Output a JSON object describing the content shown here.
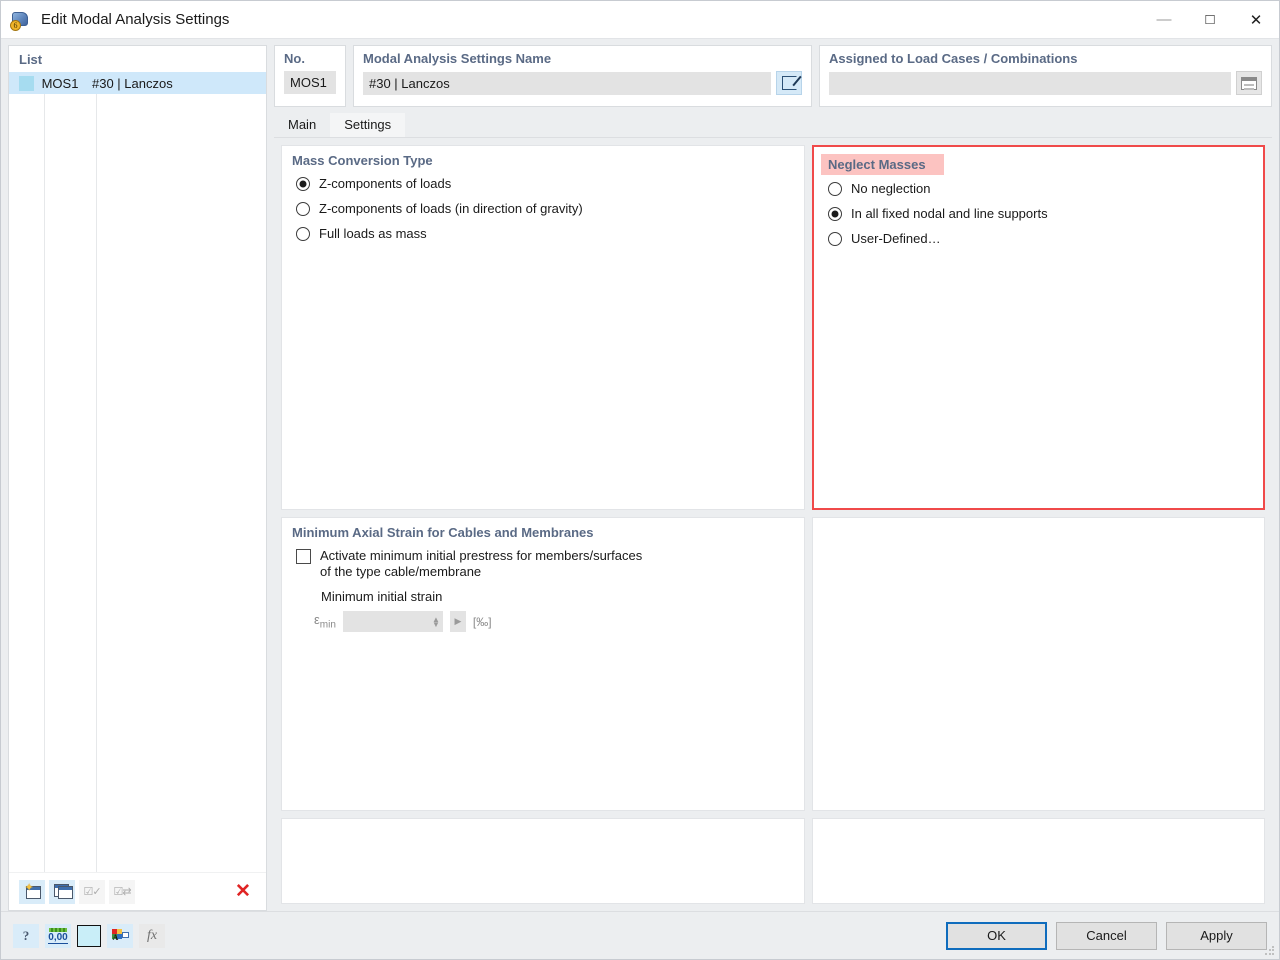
{
  "window": {
    "title": "Edit Modal Analysis Settings",
    "icon": "modal-analysis-cube-icon",
    "minimize": "—",
    "maximize": "□",
    "close": "✕"
  },
  "list": {
    "header": "List",
    "rows": [
      {
        "swatch_color": "#a6dcf0",
        "id": "MOS1",
        "name": "#30 | Lanczos"
      }
    ],
    "toolbar": [
      {
        "name": "new-item-button",
        "enabled": true
      },
      {
        "name": "copy-item-button",
        "enabled": true
      },
      {
        "name": "select-all-button",
        "enabled": false
      },
      {
        "name": "invert-selection-button",
        "enabled": false
      },
      {
        "name": "delete-item-button",
        "label": "✕",
        "enabled": true
      }
    ]
  },
  "no_field": {
    "label": "No.",
    "value": "MOS1"
  },
  "name_field": {
    "label": "Modal Analysis Settings Name",
    "value": "#30 | Lanczos",
    "edit_button": "edit-name-button"
  },
  "assigned_field": {
    "label": "Assigned to Load Cases / Combinations",
    "value": "",
    "placeholder": "",
    "picker_button": "load-case-picker-button"
  },
  "tabs": [
    {
      "label": "Main",
      "active": false
    },
    {
      "label": "Settings",
      "active": true
    }
  ],
  "mass_conversion": {
    "title": "Mass Conversion Type",
    "options": [
      {
        "label": "Z-components of loads",
        "selected": true
      },
      {
        "label": "Z-components of loads (in direction of gravity)",
        "selected": false
      },
      {
        "label": "Full loads as mass",
        "selected": false
      }
    ]
  },
  "neglect_masses": {
    "title": "Neglect Masses",
    "highlight_color": "#fcc3c1",
    "border_color": "#f04a4a",
    "options": [
      {
        "label": "No neglection",
        "selected": false
      },
      {
        "label": "In all fixed nodal and line supports",
        "selected": true
      },
      {
        "label": "User-Defined…",
        "selected": false
      }
    ]
  },
  "min_axial_strain": {
    "title": "Minimum Axial Strain for Cables and Membranes",
    "checkbox": {
      "label_line1": "Activate minimum initial prestress for members/surfaces",
      "label_line2": "of the type cable/membrane",
      "checked": false
    },
    "sub_label": "Minimum initial strain",
    "symbol": "ε",
    "symbol_sub": "min",
    "value": "",
    "unit": "[‰]",
    "enabled": false
  },
  "footer": {
    "tools": [
      {
        "name": "help-button",
        "glyph": "?"
      },
      {
        "name": "units-button",
        "glyph": "0,00"
      },
      {
        "name": "color-swatch-button",
        "color": "#c9eef8"
      },
      {
        "name": "display-properties-button",
        "glyph": "A"
      },
      {
        "name": "formula-button",
        "glyph": "fx",
        "enabled": false
      }
    ],
    "buttons": [
      {
        "label": "OK",
        "primary": true
      },
      {
        "label": "Cancel",
        "primary": false
      },
      {
        "label": "Apply",
        "primary": false
      }
    ]
  }
}
